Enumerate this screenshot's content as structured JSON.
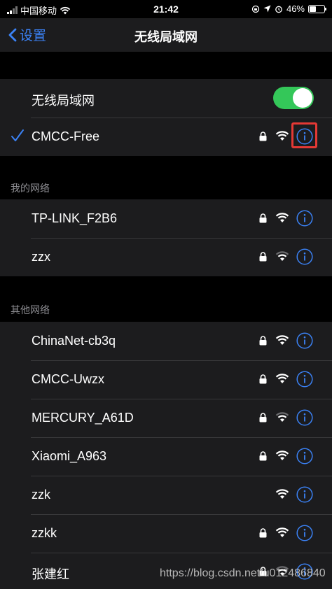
{
  "status_bar": {
    "carrier": "中国移动",
    "time": "21:42",
    "battery": "46%",
    "battery_level": 0.46
  },
  "nav": {
    "back_label": "设置",
    "title": "无线局域网"
  },
  "wifi_toggle": {
    "label": "无线局域网",
    "on": true
  },
  "current": {
    "name": "CMCC-Free"
  },
  "my_networks": {
    "header": "我的网络",
    "items": [
      {
        "name": "TP-LINK_F2B6",
        "locked": true,
        "signal": 3
      },
      {
        "name": "zzx",
        "locked": true,
        "signal": 2
      }
    ]
  },
  "other_networks": {
    "header": "其他网络",
    "items": [
      {
        "name": "ChinaNet-cb3q",
        "locked": true,
        "signal": 3
      },
      {
        "name": "CMCC-Uwzx",
        "locked": true,
        "signal": 3
      },
      {
        "name": "MERCURY_A61D",
        "locked": true,
        "signal": 2
      },
      {
        "name": "Xiaomi_A963",
        "locked": true,
        "signal": 3
      },
      {
        "name": "zzk",
        "locked": false,
        "signal": 3
      },
      {
        "name": "zzkk",
        "locked": true,
        "signal": 3
      },
      {
        "name": "张建红",
        "locked": true,
        "signal": 2
      }
    ]
  },
  "watermark": "https://blog.csdn.net/u012486840",
  "colors": {
    "accent": "#3b82f6",
    "toggle_on": "#34c759",
    "highlight_box": "#e53935"
  }
}
